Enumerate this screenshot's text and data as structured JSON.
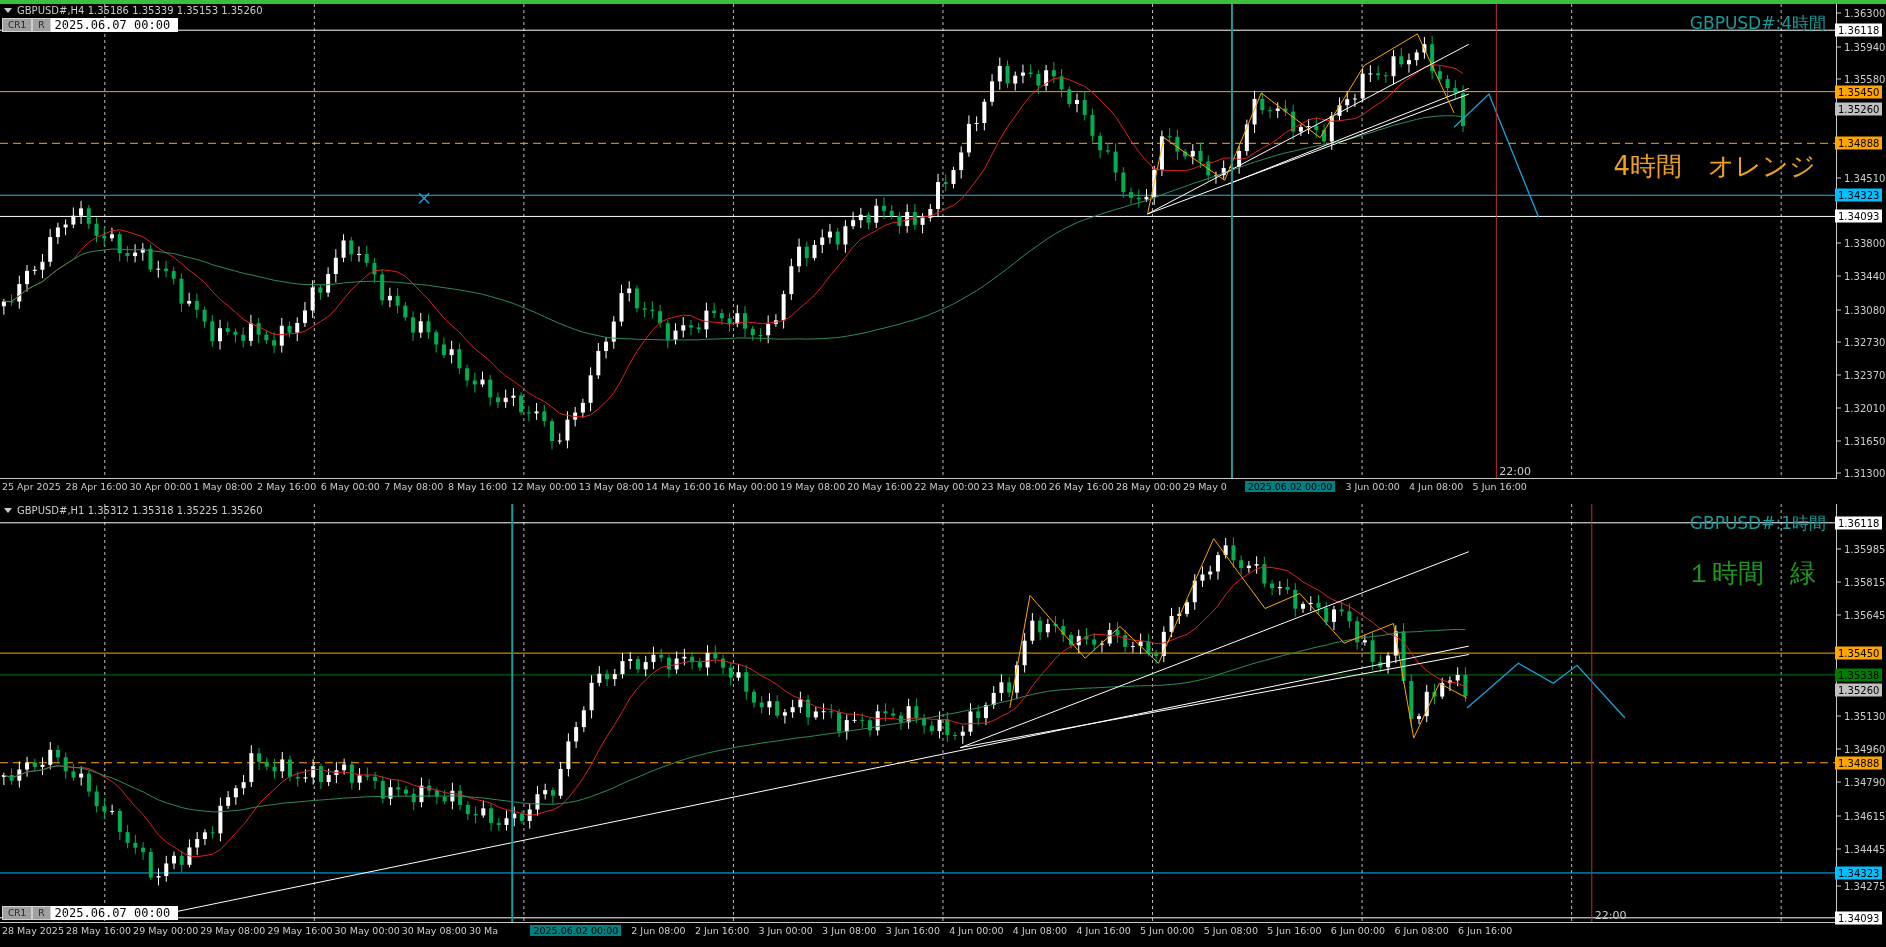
{
  "panes": [
    {
      "active": true,
      "symbol_info": "GBPUSD#,H4  1.35186 1.35339 1.35153 1.35260",
      "buttons": [
        "CR1",
        "R"
      ],
      "date_field": "2025.06.07 00:00",
      "chart_title": "GBPUSD#:4時間",
      "note": {
        "text": "4時間　オレンジ",
        "color": "#f0a020"
      },
      "marker_label": "22:00",
      "price_ticks": [
        "1.36300",
        "1.35940",
        "1.35580",
        "1.34510",
        "1.33800",
        "1.33440",
        "1.33080",
        "1.32730",
        "1.32370",
        "1.32010",
        "1.31650",
        "1.31300"
      ],
      "price_badges": [
        {
          "value": "1.36118",
          "color": "#ffffff",
          "kind": "solid"
        },
        {
          "value": "1.35450",
          "color": "#ffa500",
          "kind": "solid"
        },
        {
          "value": "1.35260",
          "color": "#c0c0c0",
          "kind": "none"
        },
        {
          "value": "1.34888",
          "color": "#ffa500",
          "kind": "dashed"
        },
        {
          "value": "1.34323",
          "color": "#00bfff",
          "kind": "solid"
        },
        {
          "value": "1.34093",
          "color": "#ffffff",
          "kind": "solid"
        }
      ],
      "time_labels": [
        {
          "text": "25 Apr 2025",
          "selected": false
        },
        {
          "text": "28 Apr 16:00",
          "selected": false
        },
        {
          "text": "30 Apr 00:00",
          "selected": false
        },
        {
          "text": "1 May 08:00",
          "selected": false
        },
        {
          "text": "2 May 16:00",
          "selected": false
        },
        {
          "text": "6 May 00:00",
          "selected": false
        },
        {
          "text": "7 May 08:00",
          "selected": false
        },
        {
          "text": "8 May 16:00",
          "selected": false
        },
        {
          "text": "12 May 00:00",
          "selected": false
        },
        {
          "text": "13 May 08:00",
          "selected": false
        },
        {
          "text": "14 May 16:00",
          "selected": false
        },
        {
          "text": "16 May 00:00",
          "selected": false
        },
        {
          "text": "19 May 08:00",
          "selected": false
        },
        {
          "text": "20 May 16:00",
          "selected": false
        },
        {
          "text": "22 May 00:00",
          "selected": false
        },
        {
          "text": "23 May 08:00",
          "selected": false
        },
        {
          "text": "26 May 16:00",
          "selected": false
        },
        {
          "text": "28 May 00:00",
          "selected": false
        },
        {
          "text": "29 May 0",
          "selected": false
        },
        {
          "text": "2025.06.02 00:00",
          "selected": true
        },
        {
          "text": "3 Jun 00:00",
          "selected": false
        },
        {
          "text": "4 Jun 08:00",
          "selected": false
        },
        {
          "text": "5 Jun 16:00",
          "selected": false
        }
      ]
    },
    {
      "active": false,
      "symbol_info": "GBPUSD#,H1  1.35312 1.35318 1.35225 1.35260",
      "buttons": [
        "CR1",
        "R"
      ],
      "date_field": "2025.06.07 00:00",
      "chart_title": "GBPUSD#:1時間",
      "note": {
        "text": "１時間　緑",
        "color": "#1e9a1e"
      },
      "marker_label": "22:00",
      "price_ticks": [
        "1.35985",
        "1.35815",
        "1.35645",
        "1.35130",
        "1.34960",
        "1.34790",
        "1.34615",
        "1.34445",
        "1.34275"
      ],
      "price_badges": [
        {
          "value": "1.36118",
          "color": "#ffffff",
          "kind": "solid"
        },
        {
          "value": "1.35450",
          "color": "#ffa500",
          "kind": "solid"
        },
        {
          "value": "1.35338",
          "color": "#007a00",
          "kind": "solid"
        },
        {
          "value": "1.35260",
          "color": "#c0c0c0",
          "kind": "none"
        },
        {
          "value": "1.34888",
          "color": "#ffa500",
          "kind": "dashed"
        },
        {
          "value": "1.34323",
          "color": "#00bfff",
          "kind": "solid"
        },
        {
          "value": "1.34093",
          "color": "#ffffff",
          "kind": "solid"
        }
      ],
      "time_labels": [
        {
          "text": "28 May 2025",
          "selected": false
        },
        {
          "text": "28 May 16:00",
          "selected": false
        },
        {
          "text": "29 May 00:00",
          "selected": false
        },
        {
          "text": "29 May 08:00",
          "selected": false
        },
        {
          "text": "29 May 16:00",
          "selected": false
        },
        {
          "text": "30 May 00:00",
          "selected": false
        },
        {
          "text": "30 May 08:00",
          "selected": false
        },
        {
          "text": "30 Ma",
          "selected": false
        },
        {
          "text": "2025.06.02 00:00",
          "selected": true
        },
        {
          "text": "2 Jun 08:00",
          "selected": false
        },
        {
          "text": "2 Jun 16:00",
          "selected": false
        },
        {
          "text": "3 Jun 00:00",
          "selected": false
        },
        {
          "text": "3 Jun 08:00",
          "selected": false
        },
        {
          "text": "3 Jun 16:00",
          "selected": false
        },
        {
          "text": "4 Jun 00:00",
          "selected": false
        },
        {
          "text": "4 Jun 08:00",
          "selected": false
        },
        {
          "text": "4 Jun 16:00",
          "selected": false
        },
        {
          "text": "5 Jun 00:00",
          "selected": false
        },
        {
          "text": "5 Jun 08:00",
          "selected": false
        },
        {
          "text": "5 Jun 16:00",
          "selected": false
        },
        {
          "text": "6 Jun 00:00",
          "selected": false
        },
        {
          "text": "6 Jun 08:00",
          "selected": false
        },
        {
          "text": "6 Jun 16:00",
          "selected": false
        }
      ]
    }
  ]
}
